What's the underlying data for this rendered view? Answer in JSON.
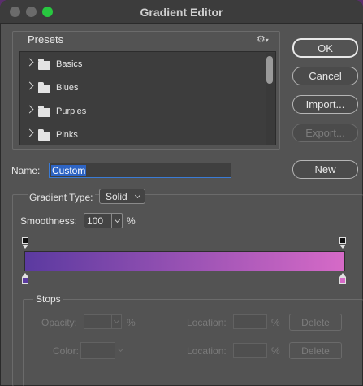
{
  "window": {
    "title": "Gradient Editor"
  },
  "presets": {
    "label": "Presets",
    "items": [
      {
        "label": "Basics"
      },
      {
        "label": "Blues"
      },
      {
        "label": "Purples"
      },
      {
        "label": "Pinks"
      }
    ]
  },
  "buttons": {
    "ok": "OK",
    "cancel": "Cancel",
    "import": "Import...",
    "export": "Export...",
    "new": "New"
  },
  "name": {
    "label": "Name:",
    "value": "Custom"
  },
  "gradient": {
    "type_label": "Gradient Type:",
    "type_value": "Solid",
    "smoothness_label": "Smoothness:",
    "smoothness_value": "100",
    "smoothness_unit": "%",
    "color_start": "#5b3aa0",
    "color_end": "#d66ac7"
  },
  "stops": {
    "label": "Stops",
    "opacity_label": "Opacity:",
    "opacity_unit": "%",
    "location_label": "Location:",
    "location_unit": "%",
    "color_label": "Color:",
    "delete_label": "Delete"
  },
  "colors": {
    "close": "#ff5f57",
    "minimize": "#febc2e",
    "zoom": "#28c840"
  }
}
